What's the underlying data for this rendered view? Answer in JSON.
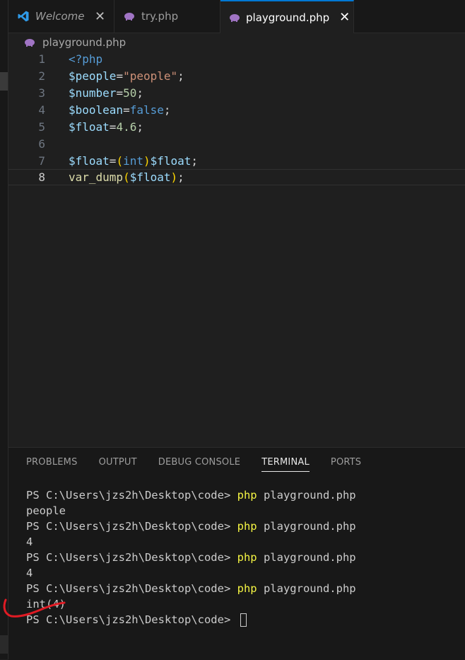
{
  "tabs": [
    {
      "label": "Welcome",
      "icon": "vscode-icon",
      "italic": true
    },
    {
      "label": "try.php",
      "icon": "php-elephant-icon",
      "italic": false
    },
    {
      "label": "playground.php",
      "icon": "php-elephant-icon",
      "italic": false,
      "active": true
    }
  ],
  "breadcrumb": {
    "file": "playground.php"
  },
  "editor": {
    "lines": [
      {
        "num": "1"
      },
      {
        "num": "2"
      },
      {
        "num": "3"
      },
      {
        "num": "4"
      },
      {
        "num": "5"
      },
      {
        "num": "6"
      },
      {
        "num": "7"
      },
      {
        "num": "8"
      }
    ],
    "code": {
      "l1_tag": "<?php",
      "l2_var": "$people",
      "l2_eq": "=",
      "l2_str": "\"people\"",
      "l2_end": ";",
      "l3_var": "$number",
      "l3_eq": "=",
      "l3_num": "50",
      "l3_end": ";",
      "l4_var": "$boolean",
      "l4_eq": "=",
      "l4_kw": "false",
      "l4_end": ";",
      "l5_var": "$float",
      "l5_eq": "=",
      "l5_num": "4.6",
      "l5_end": ";",
      "l7_var": "$float",
      "l7_eq": "=",
      "l7_open": "(",
      "l7_kw": "int",
      "l7_close": ")",
      "l7_var2": "$float",
      "l7_end": ";",
      "l8_fn": "var_dump",
      "l8_open": "(",
      "l8_var": "$float",
      "l8_close": ")",
      "l8_end": ";"
    },
    "current_line": "8"
  },
  "panel": {
    "tabs": [
      "PROBLEMS",
      "OUTPUT",
      "DEBUG CONSOLE",
      "TERMINAL",
      "PORTS"
    ],
    "active_tab": "TERMINAL",
    "terminal": {
      "prompt": "PS C:\\Users\\jzs2h\\Desktop\\code> ",
      "cmd": "php",
      "arg": " playground.php",
      "outputs": [
        "people",
        "4",
        "4",
        "int(4)"
      ]
    }
  },
  "colors": {
    "accent": "#0078d4",
    "annotation": "#e01b24"
  }
}
